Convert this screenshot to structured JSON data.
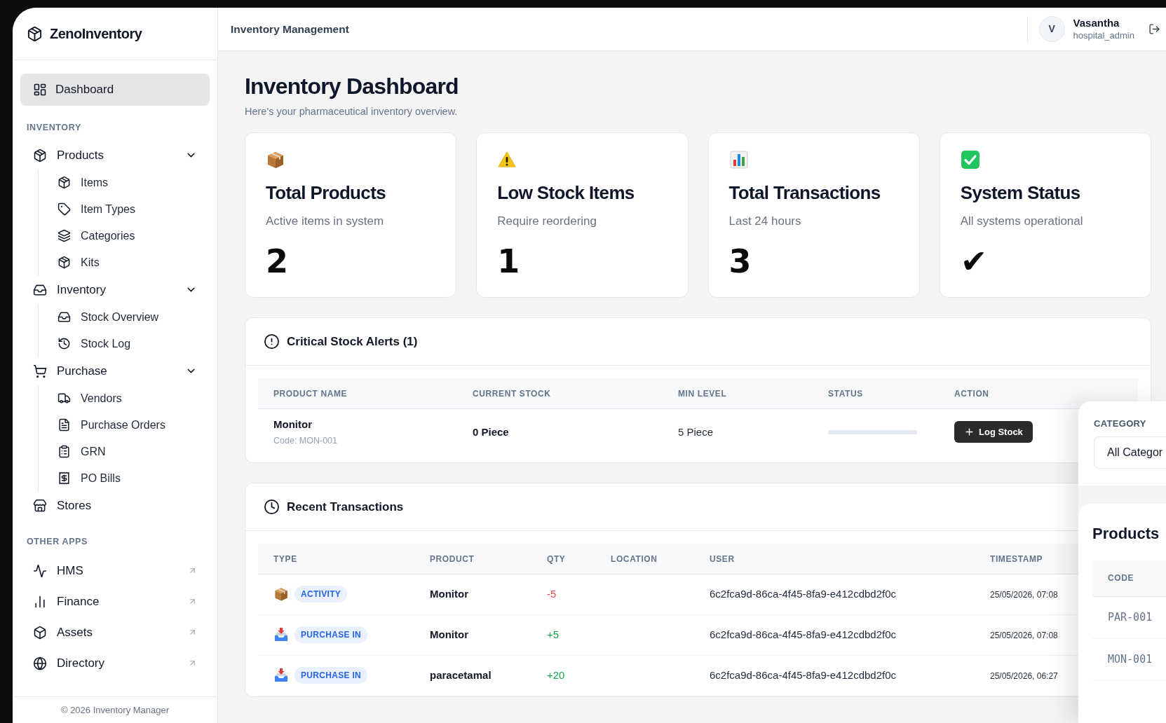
{
  "app": {
    "name": "ZenoInventory"
  },
  "sidebar": {
    "dashboard": {
      "label": "Dashboard",
      "selected": true
    },
    "sections": [
      {
        "title": "INVENTORY",
        "items": [
          {
            "label": "Products",
            "selected": false,
            "expanded": true,
            "children": [
              {
                "label": "Items",
                "selected": false
              },
              {
                "label": "Item Types",
                "selected": false
              },
              {
                "label": "Categories",
                "selected": false
              },
              {
                "label": "Kits",
                "selected": false
              }
            ]
          },
          {
            "label": "Inventory",
            "selected": false,
            "expanded": true,
            "children": [
              {
                "label": "Stock Overview",
                "selected": false
              },
              {
                "label": "Stock Log",
                "selected": false
              }
            ]
          },
          {
            "label": "Purchase",
            "selected": false,
            "expanded": true,
            "children": [
              {
                "label": "Vendors",
                "selected": false
              },
              {
                "label": "Purchase Orders",
                "selected": false
              },
              {
                "label": "GRN",
                "selected": false
              },
              {
                "label": "PO Bills",
                "selected": false
              }
            ]
          },
          {
            "label": "Stores",
            "selected": false
          }
        ]
      },
      {
        "title": "OTHER APPS",
        "items": [
          {
            "label": "HMS",
            "selected": false,
            "external": true
          },
          {
            "label": "Finance",
            "selected": false,
            "external": true
          },
          {
            "label": "Assets",
            "selected": false,
            "external": true
          },
          {
            "label": "Directory",
            "selected": false,
            "external": true
          }
        ]
      }
    ],
    "footer": "© 2026 Inventory Manager"
  },
  "header": {
    "title": "Inventory Management",
    "user": {
      "initial": "V",
      "name": "Vasantha",
      "role": "hospital_admin"
    }
  },
  "page": {
    "title": "Inventory Dashboard",
    "subtitle": "Here's your pharmaceutical inventory overview."
  },
  "stats": [
    {
      "title": "Total Products",
      "subtitle": "Active items in system",
      "value": "2"
    },
    {
      "title": "Low Stock Items",
      "subtitle": "Require reordering",
      "value": "1"
    },
    {
      "title": "Total Transactions",
      "subtitle": "Last 24 hours",
      "value": "3"
    },
    {
      "title": "System Status",
      "subtitle": "All systems operational",
      "value": "✔"
    }
  ],
  "alerts": {
    "title": "Critical Stock Alerts (1)",
    "columns": [
      "PRODUCT NAME",
      "CURRENT STOCK",
      "MIN LEVEL",
      "STATUS",
      "ACTION"
    ],
    "rows": [
      {
        "product": "Monitor",
        "code": "Code: MON-001",
        "current_stock": "0 Piece",
        "min_level": "5 Piece",
        "level": 0,
        "action": "Log Stock"
      }
    ]
  },
  "transactions": {
    "title": "Recent Transactions",
    "columns": [
      "TYPE",
      "PRODUCT",
      "QTY",
      "LOCATION",
      "USER",
      "TIMESTAMP"
    ],
    "rows": [
      {
        "kind": "activity",
        "type": "ACTIVITY",
        "product": "Monitor",
        "qty": "-5",
        "color": "#ef4444",
        "user": "6c2fca9d-86ca-4f45-8fa9-e412cdbd2f0c",
        "timestamp": "25/05/2026, 07:08"
      },
      {
        "kind": "purchase_in",
        "type": "PURCHASE IN",
        "product": "Monitor",
        "qty": "+5",
        "color": "#16a34a",
        "user": "6c2fca9d-86ca-4f45-8fa9-e412cdbd2f0c",
        "timestamp": "25/05/2026, 07:08"
      },
      {
        "kind": "purchase_in",
        "type": "PURCHASE IN",
        "product": "paracetamal",
        "qty": "+20",
        "color": "#16a34a",
        "user": "6c2fca9d-86ca-4f45-8fa9-e412cdbd2f0c",
        "timestamp": "25/05/2026, 06:27"
      }
    ]
  },
  "overlay": {
    "filter": {
      "label": "CATEGORY",
      "value": "All Categor"
    },
    "products": {
      "title": "Products",
      "columns": [
        "CODE"
      ],
      "rows": [
        {
          "code": "PAR-001"
        },
        {
          "code": "MON-001"
        }
      ]
    }
  }
}
